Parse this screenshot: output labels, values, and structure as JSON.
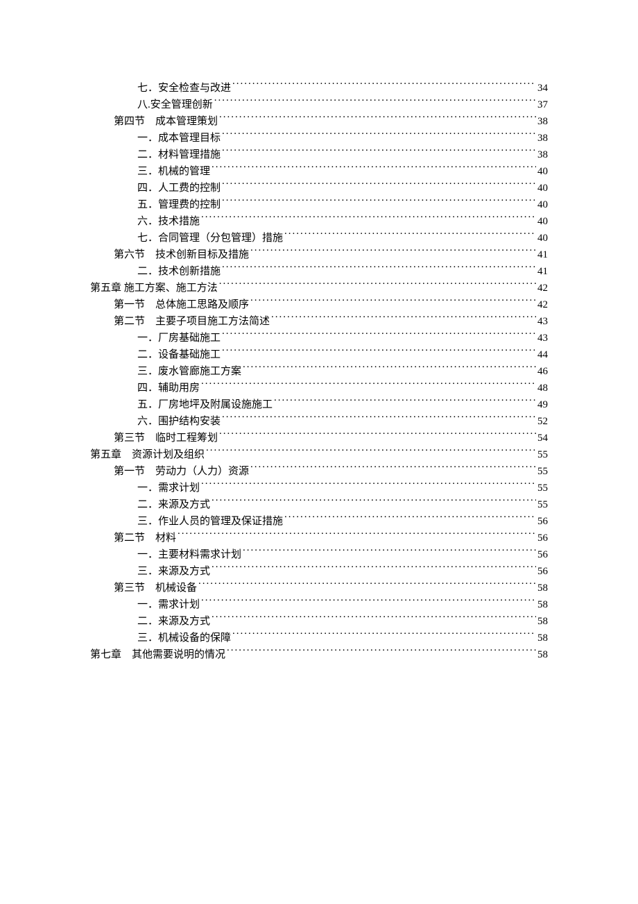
{
  "toc": [
    {
      "indent": 2,
      "label": "七．安全检查与改进",
      "page": "34"
    },
    {
      "indent": 2,
      "label": "八.安全管理创新",
      "page": "37"
    },
    {
      "indent": 1,
      "label": "第四节　成本管理策划",
      "page": "38"
    },
    {
      "indent": 2,
      "label": "一．成本管理目标",
      "page": "38"
    },
    {
      "indent": 2,
      "label": "二．材料管理措施",
      "page": "38"
    },
    {
      "indent": 2,
      "label": "三．机械的管理",
      "page": "40"
    },
    {
      "indent": 2,
      "label": "四．人工费的控制",
      "page": "40"
    },
    {
      "indent": 2,
      "label": "五．管理费的控制",
      "page": "40"
    },
    {
      "indent": 2,
      "label": "六．技术措施",
      "page": "40"
    },
    {
      "indent": 2,
      "label": "七．合同管理（分包管理）措施",
      "page": "40"
    },
    {
      "indent": 1,
      "label": "第六节　技术创新目标及措施",
      "page": "41"
    },
    {
      "indent": 2,
      "label": "二．技术创新措施",
      "page": "41"
    },
    {
      "indent": 0,
      "label": "第五章 施工方案、施工方法",
      "page": "42"
    },
    {
      "indent": 1,
      "label": "第一节　总体施工思路及顺序",
      "page": "42"
    },
    {
      "indent": 1,
      "label": "第二节　主要子项目施工方法简述",
      "page": "43"
    },
    {
      "indent": 2,
      "label": "一．厂房基础施工",
      "page": "43"
    },
    {
      "indent": 2,
      "label": "二．设备基础施工",
      "page": "44"
    },
    {
      "indent": 2,
      "label": "三．废水管廊施工方案",
      "page": "46"
    },
    {
      "indent": 2,
      "label": "四．辅助用房",
      "page": "48"
    },
    {
      "indent": 2,
      "label": "五．厂房地坪及附属设施施工",
      "page": "49"
    },
    {
      "indent": 2,
      "label": "六．围护结构安装",
      "page": "52"
    },
    {
      "indent": 1,
      "label": "第三节　临时工程筹划",
      "page": "54"
    },
    {
      "indent": 0,
      "label": "第五章　资源计划及组织",
      "page": "55"
    },
    {
      "indent": 1,
      "label": "第一节　劳动力（人力）资源",
      "page": "55"
    },
    {
      "indent": 2,
      "label": "一．需求计划",
      "page": "55"
    },
    {
      "indent": 2,
      "label": "二．来源及方式",
      "page": "55"
    },
    {
      "indent": 2,
      "label": "三．作业人员的管理及保证措施",
      "page": "56"
    },
    {
      "indent": 1,
      "label": "第二节　材料",
      "page": "56"
    },
    {
      "indent": 2,
      "label": "一．主要材料需求计划",
      "page": "56"
    },
    {
      "indent": 2,
      "label": "三．来源及方式",
      "page": "56"
    },
    {
      "indent": 1,
      "label": "第三节　机械设备",
      "page": "58"
    },
    {
      "indent": 2,
      "label": "一．需求计划",
      "page": "58"
    },
    {
      "indent": 2,
      "label": "二．来源及方式",
      "page": "58"
    },
    {
      "indent": 2,
      "label": "三．机械设备的保障",
      "page": "58"
    },
    {
      "indent": 0,
      "label": "第七章　其他需要说明的情况",
      "page": "58"
    }
  ]
}
